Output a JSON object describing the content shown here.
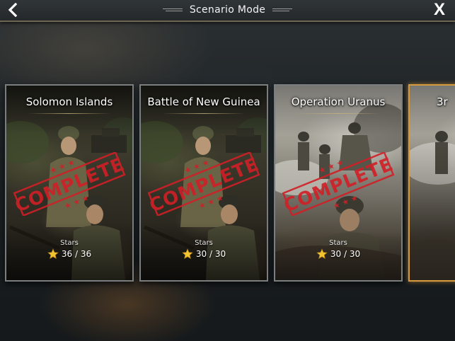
{
  "header": {
    "title": "Scenario Mode",
    "back_icon": "chevron-left-icon",
    "close_label": "X"
  },
  "scenarios": [
    {
      "title": "Solomon Islands",
      "status": "COMPLETE",
      "stars_label": "Stars",
      "stars_value": "36 / 36"
    },
    {
      "title": "Battle of New Guinea",
      "status": "COMPLETE",
      "stars_label": "Stars",
      "stars_value": "30 / 30"
    },
    {
      "title": "Operation Uranus",
      "status": "COMPLETE",
      "stars_label": "Stars",
      "stars_value": "30 / 30"
    },
    {
      "title": "3r"
    }
  ],
  "colors": {
    "accent_gold": "#d59a3e",
    "stamp_red": "#d11f26",
    "star_gold": "#f4c430"
  }
}
